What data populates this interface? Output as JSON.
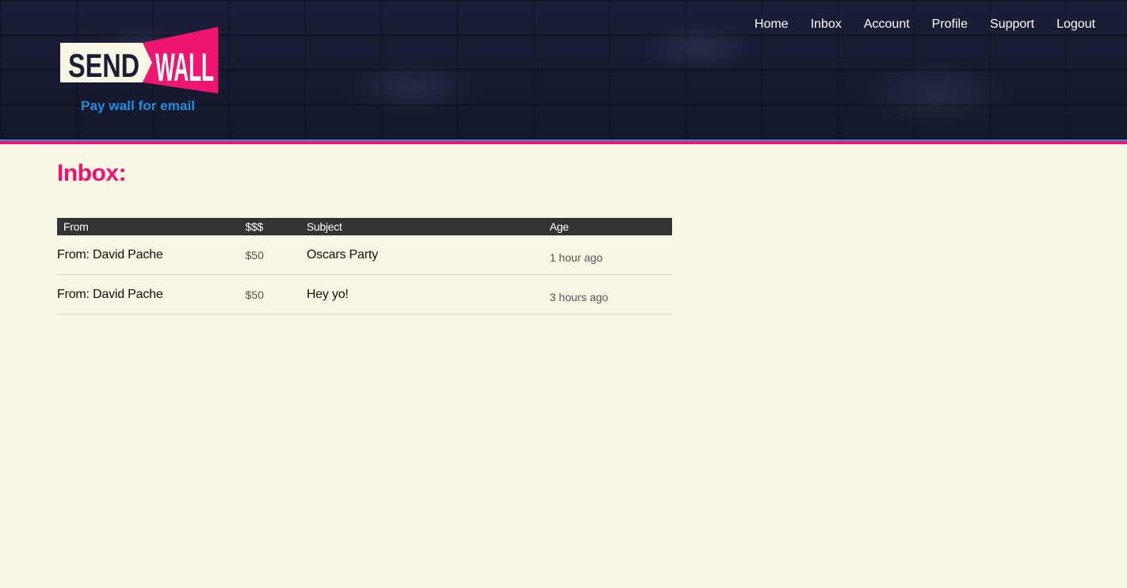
{
  "header": {
    "logo": {
      "word_left": "SEND",
      "word_right": "WALL",
      "tagline": "Pay wall for email",
      "colors": {
        "send_bg": "#f8f6e4",
        "wall_bg": "#f0166f",
        "send_text": "#1a1d33",
        "wall_text": "#ffffff",
        "tagline": "#1e8fe0"
      }
    },
    "nav": [
      {
        "label": "Home"
      },
      {
        "label": "Inbox"
      },
      {
        "label": "Account"
      },
      {
        "label": "Profile"
      },
      {
        "label": "Support"
      },
      {
        "label": "Logout"
      }
    ]
  },
  "main": {
    "title": "Inbox:",
    "table": {
      "columns": [
        "From",
        "$$$",
        "Subject",
        "Age"
      ],
      "rows": [
        {
          "from": "From: David Pache",
          "amount": "$50",
          "subject": "Oscars Party",
          "age": "1 hour ago"
        },
        {
          "from": "From: David Pache",
          "amount": "$50",
          "subject": "Hey yo!",
          "age": "3 hours ago"
        }
      ]
    }
  },
  "colors": {
    "accent": "#f0106d",
    "background": "#f8f7e5",
    "header_bg": "#161a30",
    "table_header_bg": "#333333"
  }
}
